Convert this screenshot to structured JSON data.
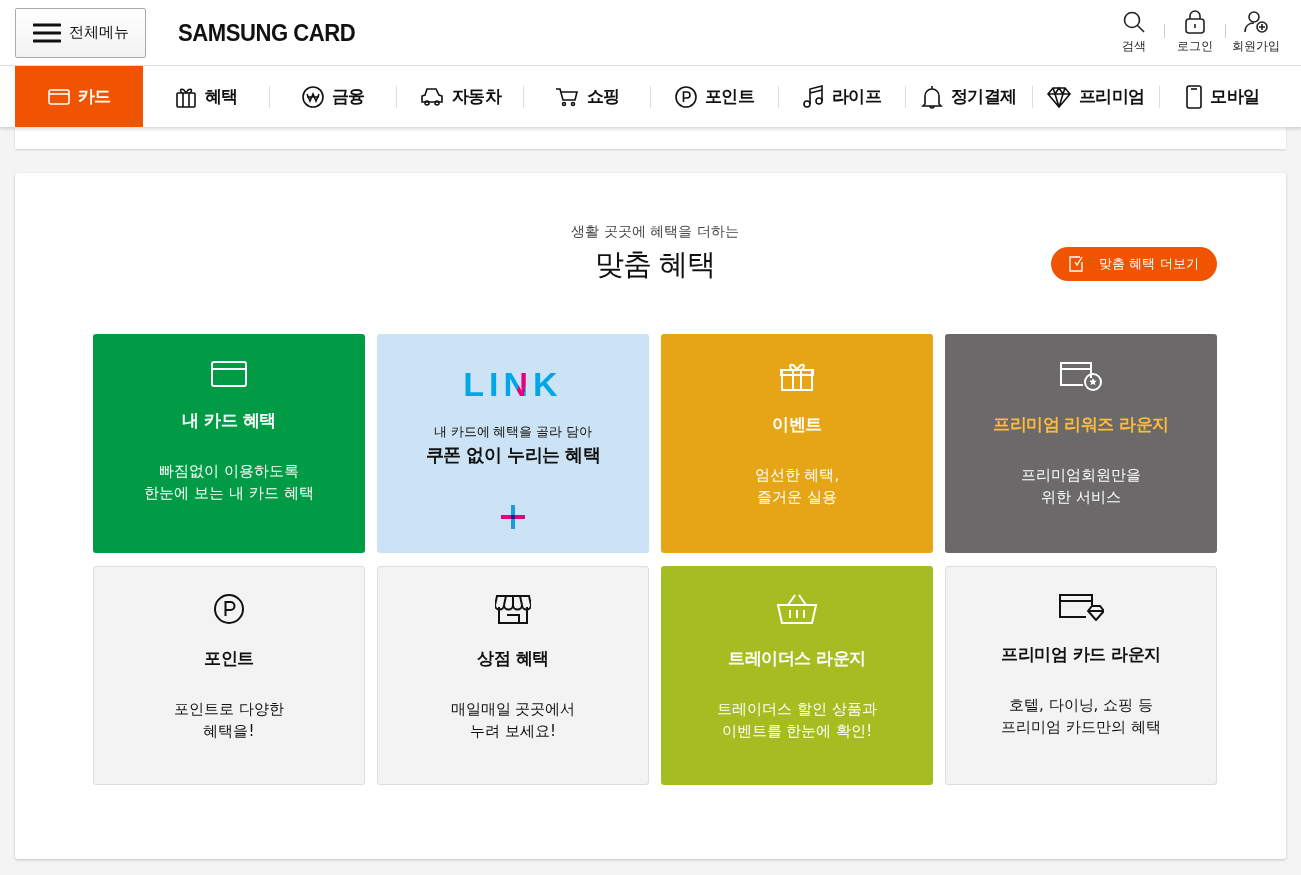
{
  "header": {
    "menu_button": "전체메뉴",
    "logo": "SAMSUNG CARD",
    "utilities": [
      {
        "label": "검색"
      },
      {
        "label": "로그인"
      },
      {
        "label": "회원가입"
      }
    ]
  },
  "nav": [
    {
      "label": "카드",
      "selected": true
    },
    {
      "label": "혜택",
      "selected": false
    },
    {
      "label": "금융",
      "selected": false
    },
    {
      "label": "자동차",
      "selected": false
    },
    {
      "label": "쇼핑",
      "selected": false
    },
    {
      "label": "포인트",
      "selected": false
    },
    {
      "label": "라이프",
      "selected": false
    },
    {
      "label": "정기결제",
      "selected": false
    },
    {
      "label": "프리미엄",
      "selected": false
    },
    {
      "label": "모바일",
      "selected": false
    }
  ],
  "section": {
    "subtitle": "생활 곳곳에 혜택을 더하는",
    "title": "맞춤 혜택",
    "more_button": "맞춤 혜택 더보기",
    "cards": [
      {
        "kind": "dark",
        "color": "#019b45",
        "title": "내 카드 혜택",
        "description": "빠짐없이 이용하도록\n한눈에 보는 내 카드 혜택"
      },
      {
        "kind": "link",
        "color": "#cbe3f4",
        "logo": "LINK",
        "caption": "내 카드에 혜택을 골라 담아",
        "title": "쿠폰 없이 누리는 혜택"
      },
      {
        "kind": "dark",
        "color": "#e5a517",
        "title": "이벤트",
        "description": "엄선한 혜택,\n즐거운 실용"
      },
      {
        "kind": "accent",
        "color": "#6b6969",
        "title": "프리미엄 리워즈 라운지",
        "description": "프리미엄회원만을\n위한 서비스"
      },
      {
        "kind": "light",
        "color": "#f3f3f3",
        "title": "포인트",
        "description": "포인트로 다양한\n혜택을!"
      },
      {
        "kind": "light",
        "color": "#f3f3f3",
        "title": "상점 혜택",
        "description": "매일매일 곳곳에서\n누려 보세요!"
      },
      {
        "kind": "dark",
        "color": "#a6bd22",
        "title": "트레이더스 라운지",
        "description": "트레이더스 할인 상품과\n이벤트를 한눈에 확인!"
      },
      {
        "kind": "light",
        "color": "#f3f3f3",
        "title": "프리미엄 카드 라운지",
        "description": "호텔, 다이닝, 쇼핑 등\n프리미엄 카드만의 혜택"
      }
    ]
  }
}
